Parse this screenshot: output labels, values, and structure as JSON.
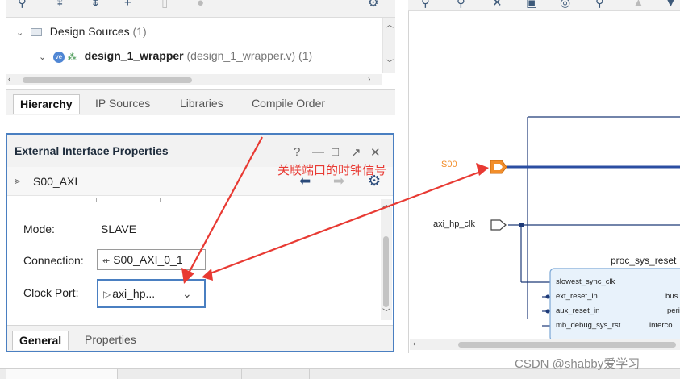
{
  "sources": {
    "tree": [
      {
        "label": "Design Sources",
        "count": "(1)"
      },
      {
        "label": "design_1_wrapper",
        "file": "(design_1_wrapper.v)",
        "count": "(1)"
      }
    ],
    "tabs": [
      "Hierarchy",
      "IP Sources",
      "Libraries",
      "Compile Order"
    ]
  },
  "properties": {
    "title": "External Interface Properties",
    "window_icons": [
      "?",
      "—",
      "□",
      "↗",
      "✕"
    ],
    "object_name": "S00_AXI",
    "mode_label": "Mode:",
    "mode_value": "SLAVE",
    "connection_label": "Connection:",
    "connection_value": "S00_AXI_0_1",
    "clock_port_label": "Clock Port:",
    "clock_port_value": "axi_hp...",
    "tabs": [
      "General",
      "Properties"
    ]
  },
  "diagram": {
    "port_s00": "S00",
    "port_clk": "axi_hp_clk",
    "block_title": "proc_sys_reset",
    "block_pins_left": [
      "slowest_sync_clk",
      "ext_reset_in",
      "aux_reset_in",
      "mb_debug_sys_rst"
    ],
    "block_pins_right": [
      "bus",
      "peri",
      "interco"
    ]
  },
  "annotation_text": "关联端口的时钟信号",
  "watermark": "CSDN @shabby爱学习",
  "colors": {
    "accent_blue": "#4a7fc1",
    "annotation_red": "#e83a33",
    "port_orange": "#f28e2b",
    "net_blue": "#2b4ea2"
  }
}
